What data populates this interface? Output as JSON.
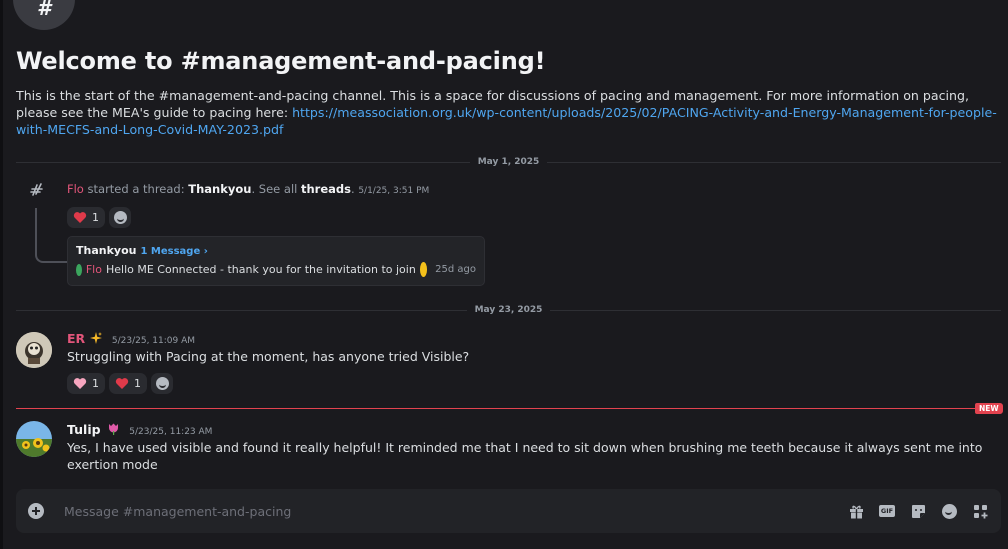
{
  "channel": {
    "hash_symbol": "#",
    "welcome_title": "Welcome to #management-and-pacing!",
    "description": "This is the start of the #management-and-pacing channel. This is a space for discussions of pacing and management. For more information on pacing, please see the MEA's guide to pacing here: ",
    "link": "https://meassociation.org.uk/wp-content/uploads/2025/02/PACING-Activity-and-Energy-Management-for-people-with-MECFS-and-Long-Covid-MAY-2023.pdf"
  },
  "dividers": [
    "May 1, 2025",
    "May 23, 2025"
  ],
  "thread_event": {
    "author": "Flo",
    "text_started": " started a thread: ",
    "thread_name": "Thankyou",
    "text_see_all": ". See all ",
    "threads_word": "threads",
    "text_end": ".",
    "timestamp": "5/1/25, 3:51 PM",
    "reactions": [
      {
        "emoji": "red-heart",
        "count": "1"
      }
    ],
    "card": {
      "title": "Thankyou",
      "message_count": "1 Message ›",
      "author": "Flo",
      "preview": "Hello ME Connected - thank you for the invitation to join",
      "ago": "25d ago"
    }
  },
  "messages": [
    {
      "author": "ER",
      "author_emoji": "sparkles",
      "author_color": "#e2557a",
      "timestamp": "5/23/25, 11:09 AM",
      "text": "Struggling with Pacing at the moment, has anyone tried Visible?",
      "reactions": [
        {
          "emoji": "pink-heart",
          "count": "1"
        },
        {
          "emoji": "red-heart",
          "count": "1"
        }
      ]
    },
    {
      "author": "Tulip",
      "author_emoji": "tulip",
      "author_color": "#f2f3f5",
      "timestamp": "5/23/25, 11:23 AM",
      "text": "Yes, I have used visible and found it really helpful! It reminded me that I need to sit down when brushing me teeth because it always sent me into exertion mode"
    }
  ],
  "new_badge": "NEW",
  "composer": {
    "placeholder": "Message #management-and-pacing",
    "gif_label": "GIF"
  },
  "colors": {
    "accent_link": "#4fa6f0",
    "new_marker": "#e2434f",
    "background": "#1a1a1e"
  }
}
